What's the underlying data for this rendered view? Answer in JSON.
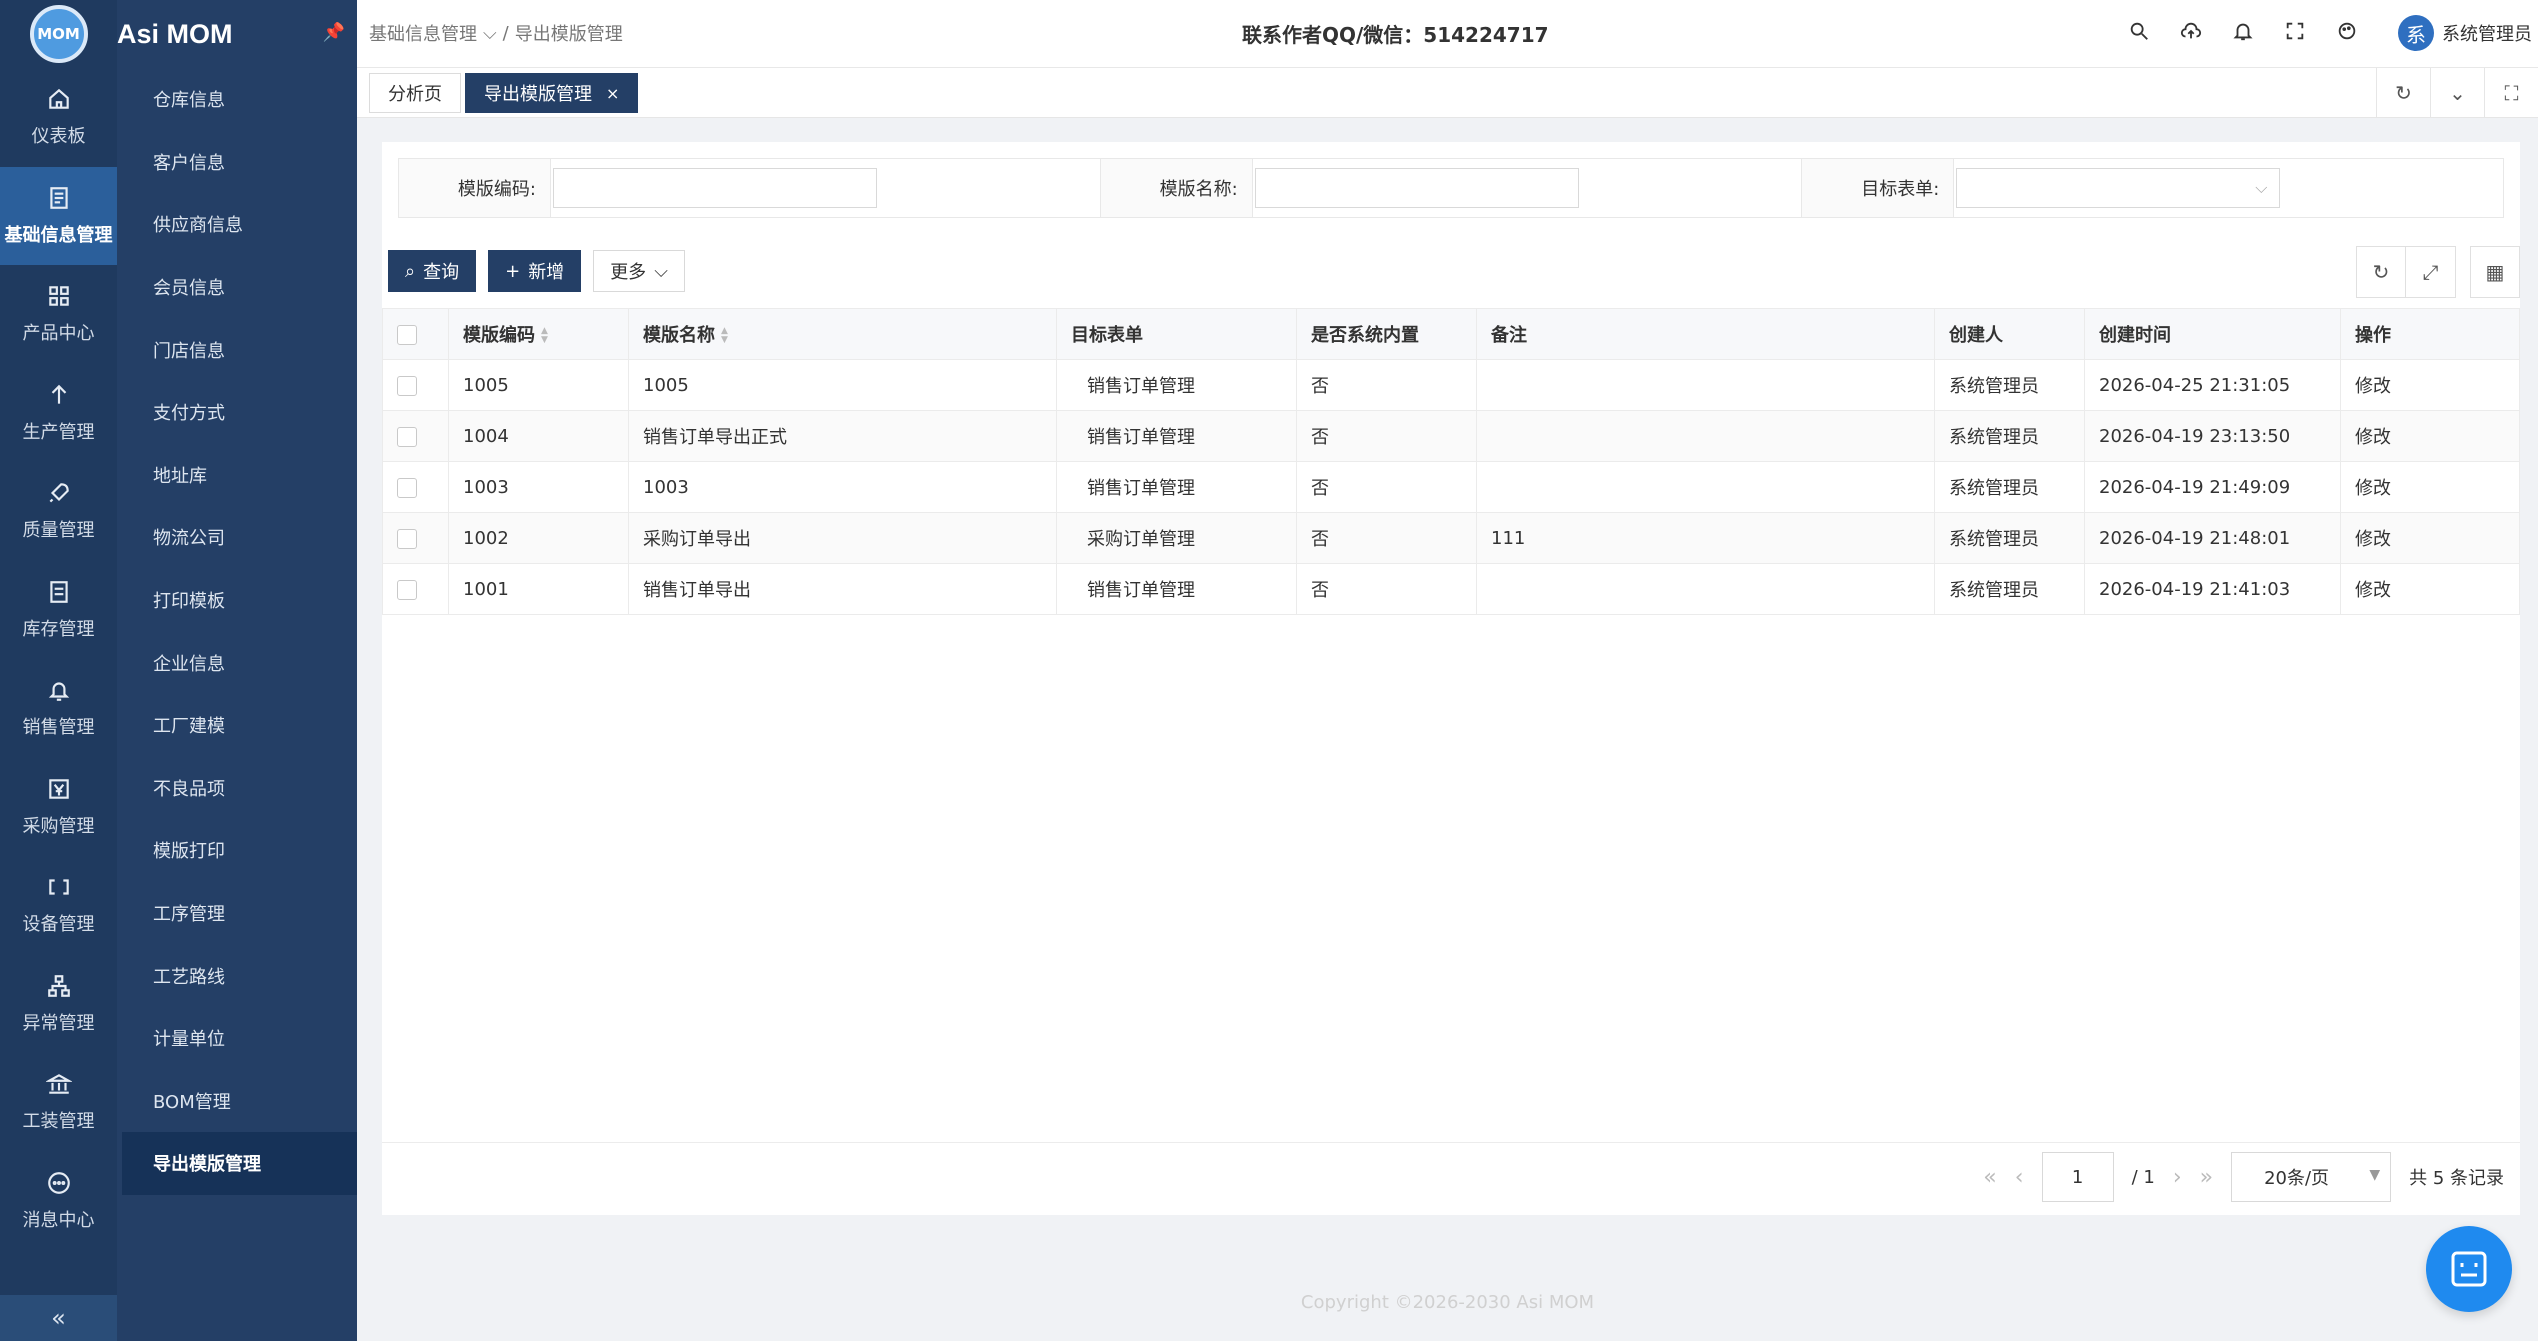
{
  "app": {
    "name": "Asi MOM",
    "logo_text": "MOM"
  },
  "rail": [
    {
      "label": "仪表板",
      "icon": "home-icon"
    },
    {
      "label": "基础信息管理",
      "icon": "document-icon",
      "active": true
    },
    {
      "label": "产品中心",
      "icon": "grid-icon"
    },
    {
      "label": "生产管理",
      "icon": "arrow-up-icon"
    },
    {
      "label": "质量管理",
      "icon": "rocket-icon"
    },
    {
      "label": "库存管理",
      "icon": "list-icon"
    },
    {
      "label": "销售管理",
      "icon": "bell-icon"
    },
    {
      "label": "采购管理",
      "icon": "yen-icon"
    },
    {
      "label": "设备管理",
      "icon": "device-icon"
    },
    {
      "label": "异常管理",
      "icon": "hierarchy-icon"
    },
    {
      "label": "工装管理",
      "icon": "bank-icon"
    },
    {
      "label": "消息中心",
      "icon": "chat-icon"
    }
  ],
  "submenu": [
    "仓库信息",
    "客户信息",
    "供应商信息",
    "会员信息",
    "门店信息",
    "支付方式",
    "地址库",
    "物流公司",
    "打印模板",
    "企业信息",
    "工厂建模",
    "不良品项",
    "模版打印",
    "工序管理",
    "工艺路线",
    "计量单位",
    "BOM管理",
    "导出模版管理"
  ],
  "header": {
    "breadcrumb_parent": "基础信息管理",
    "breadcrumb_current": "导出模版管理",
    "contact": "联系作者QQ/微信：514224717",
    "user_avatar": "系",
    "user_name": "系统管理员"
  },
  "tabs": {
    "home": "分析页",
    "current": "导出模版管理"
  },
  "filters": {
    "code_label": "模版编码:",
    "name_label": "模版名称:",
    "target_label": "目标表单:"
  },
  "toolbar": {
    "query": "查询",
    "add": "新增",
    "more": "更多"
  },
  "table": {
    "headers": [
      "模版编码",
      "模版名称",
      "目标表单",
      "是否系统内置",
      "备注",
      "创建人",
      "创建时间",
      "操作"
    ],
    "rows": [
      {
        "code": "1005",
        "name": "1005",
        "target": "销售订单管理",
        "builtin": "否",
        "remark": "",
        "creator": "系统管理员",
        "time": "2026-04-25 21:31:05",
        "action": "修改"
      },
      {
        "code": "1004",
        "name": "销售订单导出正式",
        "target": "销售订单管理",
        "builtin": "否",
        "remark": "",
        "creator": "系统管理员",
        "time": "2026-04-19 23:13:50",
        "action": "修改"
      },
      {
        "code": "1003",
        "name": "1003",
        "target": "销售订单管理",
        "builtin": "否",
        "remark": "",
        "creator": "系统管理员",
        "time": "2026-04-19 21:49:09",
        "action": "修改"
      },
      {
        "code": "1002",
        "name": "采购订单导出",
        "target": "采购订单管理",
        "builtin": "否",
        "remark": "111",
        "creator": "系统管理员",
        "time": "2026-04-19 21:48:01",
        "action": "修改"
      },
      {
        "code": "1001",
        "name": "销售订单导出",
        "target": "销售订单管理",
        "builtin": "否",
        "remark": "",
        "creator": "系统管理员",
        "time": "2026-04-19 21:41:03",
        "action": "修改"
      }
    ]
  },
  "pager": {
    "page": "1",
    "total_pages": "/ 1",
    "page_size": "20条/页",
    "total": "共 5 条记录"
  },
  "footer": "Copyright ©2026-2030 Asi MOM",
  "colors": {
    "sidebar": "#1f3a5f",
    "accent": "#243f66",
    "link": "#2e7be0"
  }
}
